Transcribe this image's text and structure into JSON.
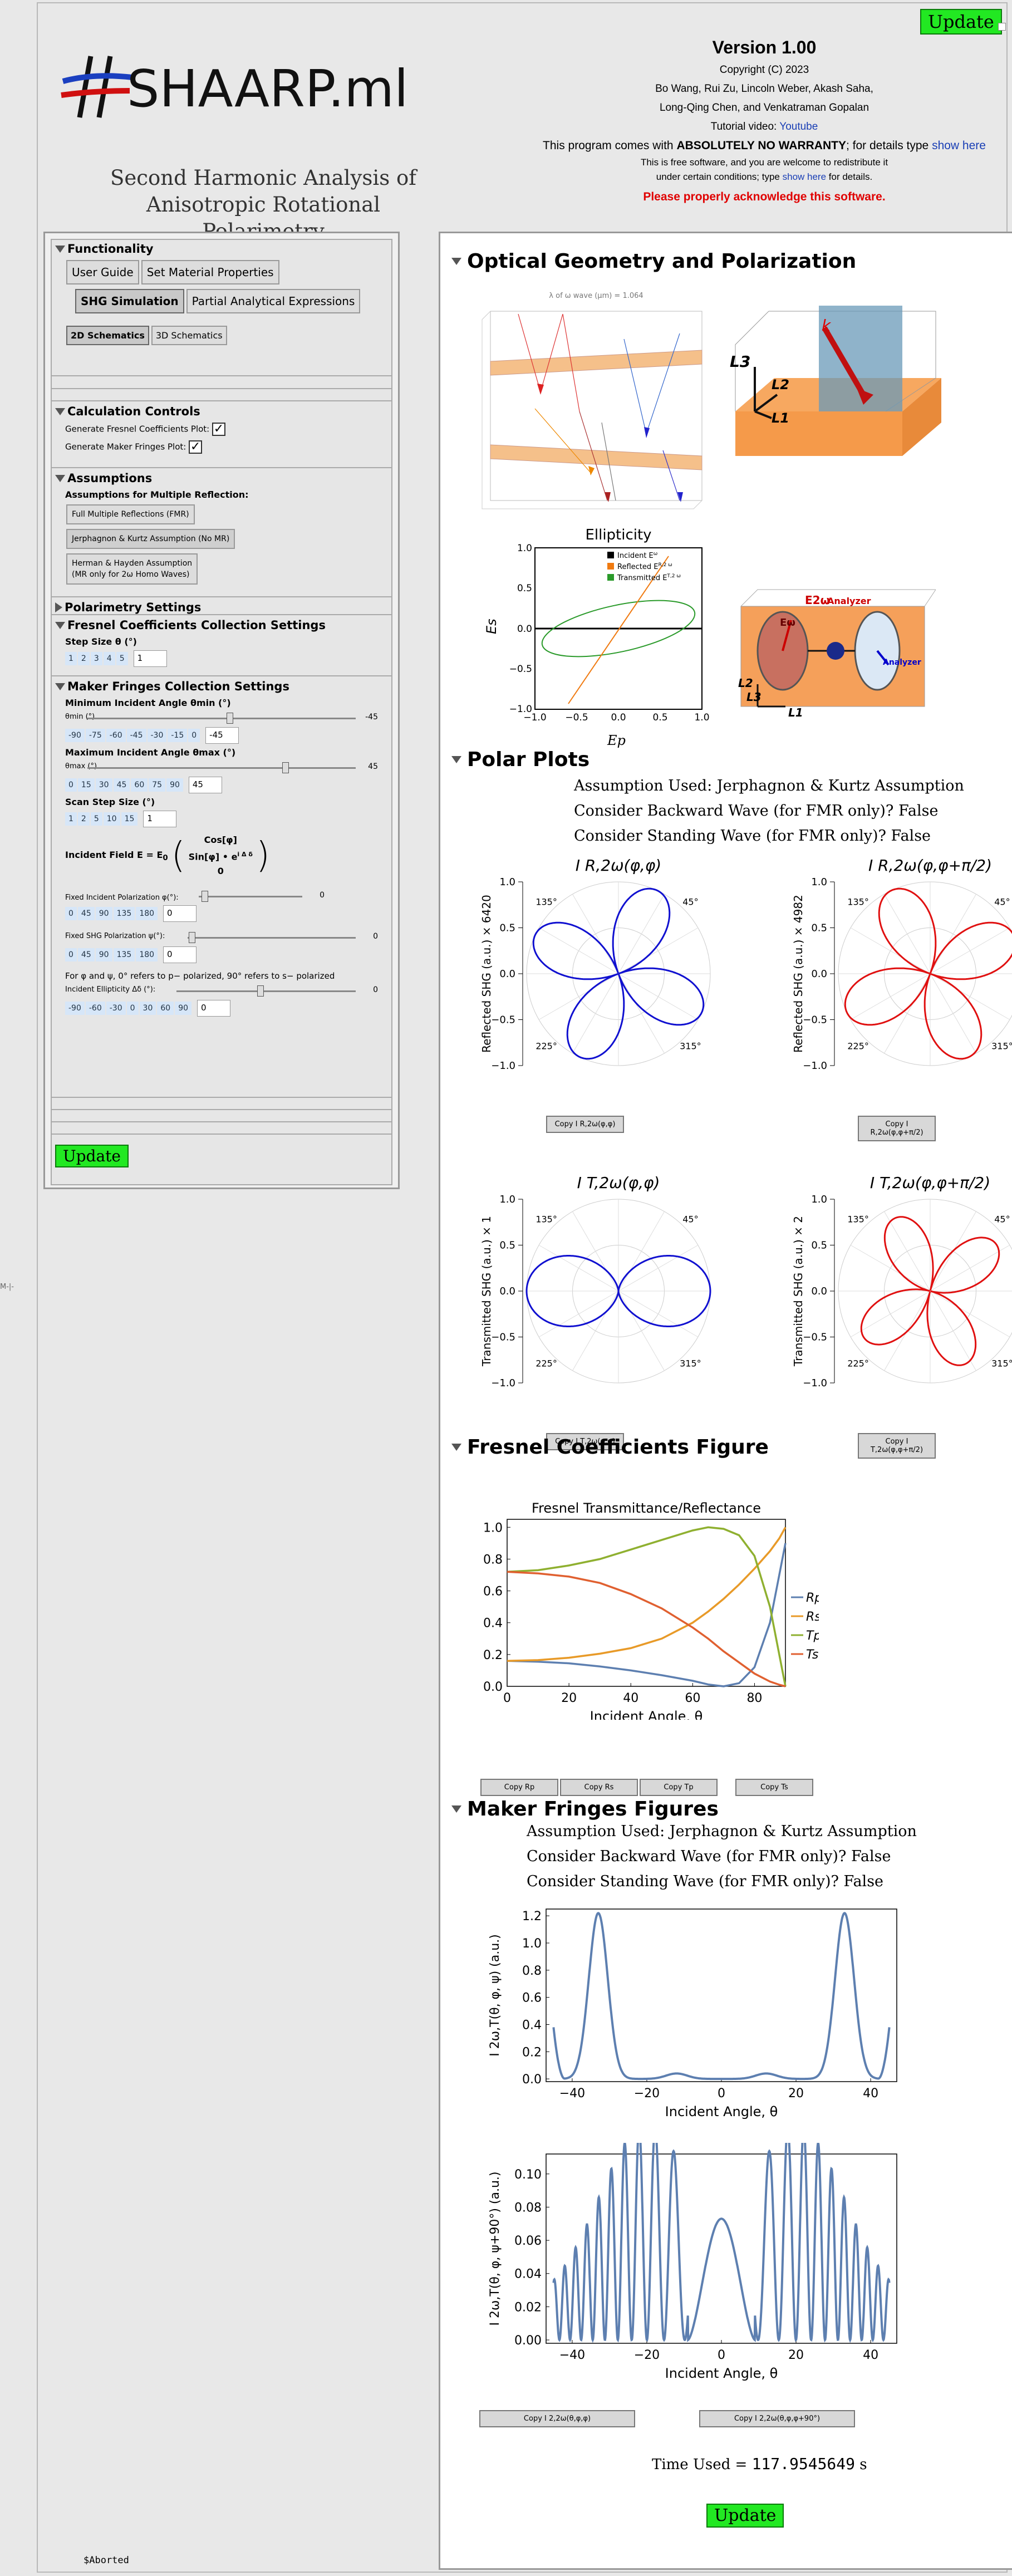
{
  "app": {
    "logo_text": "SHAARP.ml",
    "subtitle_line1": "Second Harmonic Analysis of",
    "subtitle_line2": "Anisotropic Rotational Polarimetry",
    "update_label": "Update",
    "side_label": "M-|-",
    "aborted": "$Aborted"
  },
  "header": {
    "version": "Version 1.00",
    "copyright": "Copyright (C) 2023",
    "authors1": "Bo Wang, Rui Zu, Lincoln Weber, Akash Saha,",
    "authors2": "Long-Qing Chen, and Venkatraman Gopalan",
    "tutorial_prefix": "Tutorial video: ",
    "tutorial_link": "Youtube",
    "warranty_prefix": "This program comes with ",
    "warranty_bold": "ABSOLUTELY NO WARRANTY",
    "warranty_mid": "; for details type ",
    "warranty_link": "show here",
    "free1": "This is free software, and you are welcome to redistribute it",
    "free2_prefix": "under certain conditions; type ",
    "free2_link": "show here",
    "free2_suffix": " for details.",
    "acknowledge": "Please properly acknowledge this software."
  },
  "sidebar": {
    "functionality": {
      "title": "Functionality",
      "buttons": [
        "User Guide",
        "Set Material Properties",
        "SHG Simulation",
        "Partial Analytical Expressions"
      ],
      "tabs": [
        "2D Schematics",
        "3D Schematics"
      ]
    },
    "calc": {
      "title": "Calculation Controls",
      "fresnel_label": "Generate Fresnel Coefficients Plot:",
      "maker_label": "Generate Maker Fringes Plot:",
      "check": "✓"
    },
    "assumptions": {
      "title": "Assumptions",
      "subtitle": "Assumptions for Multiple Reflection:",
      "opt1": "Full Multiple Reflections (FMR)",
      "opt2": "Jerphagnon & Kurtz Assumption (No MR)",
      "opt3a": "Herman & Hayden Assumption",
      "opt3b": "(MR only for 2ω Homo Waves)"
    },
    "polarimetry": {
      "title": "Polarimetry Settings"
    },
    "fresnel": {
      "title": "Fresnel Coefficients Collection Settings",
      "step_label": "Step Size θ (°)",
      "steps": [
        "1",
        "2",
        "3",
        "4",
        "5"
      ],
      "step_value": "1"
    },
    "maker": {
      "title": "Maker Fringes Collection Settings",
      "min_label": "Minimum Incident Angle θmin (°)",
      "min_slider_label": "θmin (°)",
      "min_value": "-45",
      "min_chips": [
        "-90",
        "-75",
        "-60",
        "-45",
        "-30",
        "-15",
        "0"
      ],
      "max_label": "Maximum Incident Angle θmax (°)",
      "max_slider_label": "θmax (°)",
      "max_value": "45",
      "max_chips": [
        "0",
        "15",
        "30",
        "45",
        "60",
        "75",
        "90"
      ],
      "scan_label": "Scan Step Size (°)",
      "scan_chips": [
        "1",
        "2",
        "5",
        "10",
        "15"
      ],
      "scan_value": "1",
      "field_label": "Incident Field E = E",
      "field_sub": "0",
      "mat1": "Cos[φ]",
      "mat2": "Sin[φ] • e",
      "mat2_sup": "i Δ δ",
      "mat3": "0",
      "fixed_inc_label": "Fixed Incident Polarization φ(°):",
      "fixed_inc_value": "0",
      "pol_chips": [
        "0",
        "45",
        "90",
        "135",
        "180"
      ],
      "fixed_shg_label": "Fixed SHG Polarization ψ(°):",
      "fixed_shg_value": "0",
      "note": "For φ and ψ, 0° refers to p− polarized, 90° refers to s− polarized",
      "ellip_label": "Incident Ellipticity Δδ (°):",
      "ellip_value": "0",
      "ellip_chips": [
        "-90",
        "-60",
        "-30",
        "0",
        "30",
        "60",
        "90"
      ]
    }
  },
  "main": {
    "optical": {
      "title": "Optical Geometry and Polarization",
      "wave_label": "λ of ω wave (μm) = 1.064",
      "k_label": "k",
      "L3": "L3",
      "L2": "L2",
      "L1": "L1",
      "ellip_title": "Ellipticity",
      "ellip_legend": [
        "Incident E",
        "Reflected E",
        "Transmitted E"
      ],
      "ellip_legend_sup": [
        "ω",
        "R,2 ω",
        "T,2 ω"
      ],
      "ellip_ylabel": "Es",
      "ellip_xlabel": "Ep",
      "ellip_xticks": [
        "−1.0",
        "−0.5",
        "0.0",
        "0.5",
        "1.0"
      ],
      "ellip_yticks": [
        "1.0",
        "0.5",
        "0.0",
        "−0.5",
        "−1.0"
      ],
      "analyzer1": "Analyzer",
      "analyzer2": "Analyzer",
      "e_omega": "Eω",
      "e_2omega": "E2ω"
    },
    "polar": {
      "title": "Polar Plots",
      "assumption": "Assumption Used: Jerphagnon & Kurtz Assumption",
      "backward": "Consider Backward Wave (for FMR only)? False",
      "standing": "Consider Standing Wave (for FMR only)? False",
      "plots": [
        {
          "title": "I R,2ω(φ,φ)",
          "ylabel": "Reflected SHG (a.u.) × 6420",
          "copy": "Copy I R,2ω(φ,φ)",
          "color": "#1010d0",
          "type": "rose4"
        },
        {
          "title": "I R,2ω(φ,φ+π/2)",
          "ylabel": "Reflected SHG (a.u.) × 4982",
          "copy": "Copy I R,2ω(φ,φ+π/2)",
          "color": "#e01010",
          "type": "rose4b"
        },
        {
          "title": "I T,2ω(φ,φ)",
          "ylabel": "Transmitted SHG (a.u.) × 1",
          "copy": "Copy I T,2ω(φ,φ)",
          "color": "#1010d0",
          "type": "eight"
        },
        {
          "title": "I T,2ω(φ,φ+π/2)",
          "ylabel": "Transmitted SHG (a.u.) × 2",
          "copy": "Copy I T,2ω(φ,φ+π/2)",
          "color": "#e01010",
          "type": "rose4c"
        }
      ],
      "angle_labels": [
        "135°",
        "45°",
        "225°",
        "315°"
      ],
      "rticks": [
        "1.0",
        "0.5",
        "0.0",
        "−0.5",
        "−1.0"
      ]
    },
    "fresnel": {
      "title": "Fresnel Coefficients Figure",
      "copy_labels": [
        "Copy Rp",
        "Copy Rs",
        "Copy Tp",
        "Copy Ts"
      ]
    },
    "maker": {
      "title": "Maker Fringes Figures",
      "assumption": "Assumption Used: Jerphagnon & Kurtz Assumption",
      "backward": "Consider Backward Wave (for FMR only)? False",
      "standing": "Consider Standing Wave (for FMR only)? False",
      "copy1": "Copy I 2,2ω(θ,φ,φ)",
      "copy2": "Copy I 2,2ω(θ,φ,φ+90°)",
      "time_prefix": "Time Used = ",
      "time_value": "117.9545649",
      "time_unit": " s"
    }
  },
  "chart_data": [
    {
      "type": "line",
      "title": "Fresnel Transmittance/Reflectance",
      "xlabel": "Incident Angle, θ",
      "ylabel": "",
      "xlim": [
        0,
        90
      ],
      "ylim": [
        0,
        1.05
      ],
      "xticks": [
        "0",
        "20",
        "40",
        "60",
        "80"
      ],
      "yticks": [
        "0.0",
        "0.2",
        "0.4",
        "0.6",
        "0.8",
        "1.0"
      ],
      "legend": "right",
      "x": [
        0,
        10,
        20,
        30,
        40,
        50,
        60,
        65,
        70,
        75,
        80,
        85,
        88,
        90
      ],
      "series": [
        {
          "name": "Rp",
          "color": "#5d7fb0",
          "values": [
            0.16,
            0.155,
            0.145,
            0.125,
            0.1,
            0.07,
            0.035,
            0.012,
            0.0,
            0.02,
            0.12,
            0.4,
            0.7,
            0.9
          ]
        },
        {
          "name": "Rs",
          "color": "#e89a28",
          "values": [
            0.16,
            0.165,
            0.18,
            0.205,
            0.24,
            0.3,
            0.4,
            0.47,
            0.55,
            0.64,
            0.74,
            0.85,
            0.93,
            1.0
          ]
        },
        {
          "name": "Tp",
          "color": "#8fb030",
          "values": [
            0.72,
            0.73,
            0.76,
            0.8,
            0.86,
            0.92,
            0.98,
            1.0,
            0.99,
            0.95,
            0.82,
            0.5,
            0.2,
            0.0
          ]
        },
        {
          "name": "Ts",
          "color": "#e06030",
          "values": [
            0.72,
            0.71,
            0.69,
            0.65,
            0.58,
            0.49,
            0.37,
            0.3,
            0.22,
            0.15,
            0.08,
            0.03,
            0.01,
            0.0
          ]
        }
      ]
    },
    {
      "type": "line",
      "title": "",
      "xlabel": "Incident Angle, θ",
      "ylabel": "I 2ω,T(θ, φ, ψ) (a.u.)",
      "xlim": [
        -47,
        47
      ],
      "ylim": [
        -0.02,
        1.25
      ],
      "xticks": [
        "−40",
        "−20",
        "0",
        "20",
        "40"
      ],
      "yticks": [
        "0.0",
        "0.2",
        "0.4",
        "0.6",
        "0.8",
        "1.0",
        "1.2"
      ],
      "series": [
        {
          "name": "",
          "color": "#5d7fb0",
          "values_desc": "computed",
          "shape": "maker1"
        }
      ]
    },
    {
      "type": "line",
      "title": "",
      "xlabel": "Incident Angle, θ",
      "ylabel": "I 2ω,T(θ, φ, ψ+90°) (a.u.)",
      "xlim": [
        -47,
        47
      ],
      "ylim": [
        -0.002,
        0.112
      ],
      "xticks": [
        "−40",
        "−20",
        "0",
        "20",
        "40"
      ],
      "yticks": [
        "0.00",
        "0.02",
        "0.04",
        "0.06",
        "0.08",
        "0.10"
      ],
      "series": [
        {
          "name": "",
          "color": "#5d7fb0",
          "values_desc": "computed",
          "shape": "maker2"
        }
      ]
    }
  ]
}
